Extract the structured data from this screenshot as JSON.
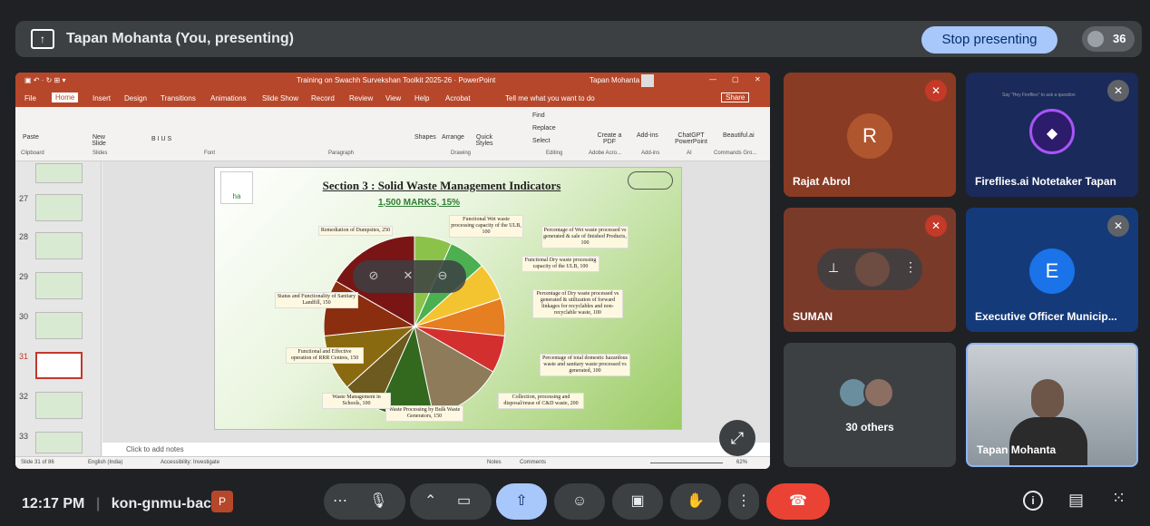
{
  "topbar": {
    "title": "Tapan Mohanta (You, presenting)",
    "stop_label": "Stop presenting",
    "participant_count": "36"
  },
  "ppt": {
    "window_title": "Training on Swachh Survekshan Toolkit 2025-26 · PowerPoint",
    "user": "Tapan Mohanta",
    "menu": [
      "File",
      "Home",
      "Insert",
      "Design",
      "Transitions",
      "Animations",
      "Slide Show",
      "Record",
      "Review",
      "View",
      "Help",
      "Acrobat"
    ],
    "tell_me": "Tell me what you want to do",
    "share": "Share",
    "ribbon": {
      "paste": "Paste",
      "new_slide": "New Slide",
      "shapes": "Shapes",
      "arrange": "Arrange",
      "quick_styles": "Quick Styles",
      "find": "Find",
      "replace": "Replace",
      "select": "Select",
      "create_pdf": "Create a PDF",
      "addins": "Add-ins",
      "chatgpt": "ChatGPT PowerPoint",
      "beautiful": "Beautiful.ai",
      "groups": [
        "Clipboard",
        "Slides",
        "Font",
        "Paragraph",
        "Drawing",
        "Editing",
        "Adobe Acro...",
        "Add-ins",
        "AI",
        "Commands Gro..."
      ]
    },
    "thumb_numbers": [
      "27",
      "28",
      "29",
      "30",
      "31",
      "32",
      "33"
    ],
    "notes_placeholder": "Click to add notes",
    "status": {
      "slide": "Slide 31 of 86",
      "lang": "English (India)",
      "access": "Accessibility: Investigate",
      "notes": "Notes",
      "comments": "Comments",
      "zoom": "62%"
    }
  },
  "slide": {
    "title": "Section 3 : Solid Waste Management Indicators",
    "subtitle": "1,500 MARKS, 15%",
    "logo_text": "ha",
    "labels": [
      "Functional Wet waste processing capacity of the ULB, 100",
      "Percentage of Wet waste processed vs generated & sale of finished Products, 100",
      "Functional Dry waste processing capacity of the ULB, 100",
      "Percentage of Dry waste processed vs generated & utilization of forward linkages for recyclables and non-recyclable waste, 100",
      "Percentage of total domestic hazardous waste and sanitary waste processed vs generated, 100",
      "Collection, processing and disposal/reuse of C&D waste, 200",
      "Waste Processing by Bulk Waste Generators, 150",
      "Waste Management in Schools, 100",
      "Functional and Effective operation of RRR Centres, 150",
      "Status and Functionality of Sanitary Landfill, 150",
      "Remediation of Dumpsites, 250"
    ]
  },
  "tiles": {
    "rajat": {
      "name": "Rajat Abrol",
      "initial": "R",
      "color": "#a0522d"
    },
    "fireflies": {
      "name": "Fireflies.ai Notetaker Tapan",
      "banner": "Say \"Hey Fireflies\" to ask a question"
    },
    "suman": {
      "name": "SUMAN"
    },
    "exec": {
      "name": "Executive Officer Municip...",
      "initial": "E",
      "color": "#1a73e8"
    },
    "others": {
      "name": "30 others"
    },
    "tapan": {
      "name": "Tapan Mohanta"
    }
  },
  "bottom": {
    "time": "12:17 PM",
    "code": "kon-gnmu-bac"
  },
  "colors": {
    "accent": "#a8c7fa",
    "end_call": "#ea4335",
    "ppt": "#b7472a"
  }
}
